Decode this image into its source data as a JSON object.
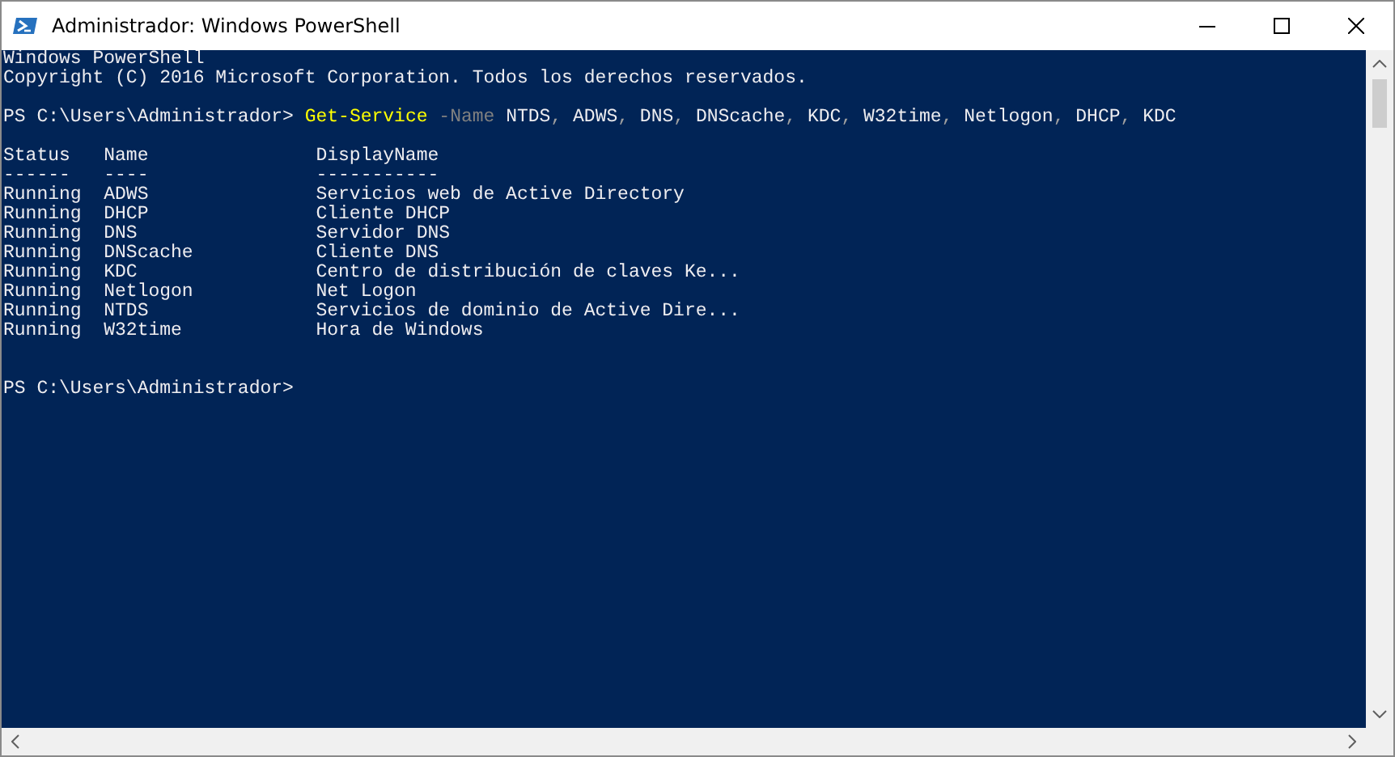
{
  "window": {
    "title": "Administrador: Windows PowerShell"
  },
  "console": {
    "banner": [
      {
        "segments": [
          {
            "kind": "plain",
            "text": "Windows PowerShell"
          }
        ]
      },
      {
        "segments": [
          {
            "kind": "plain",
            "text": "Copyright (C) 2016 Microsoft Corporation. Todos los derechos reservados."
          }
        ]
      }
    ],
    "command": {
      "segments": [
        {
          "kind": "plain",
          "text": "PS C:\\Users\\Administrador> "
        },
        {
          "kind": "command",
          "text": "Get-Service"
        },
        {
          "kind": "parameter",
          "text": " -Name"
        },
        {
          "kind": "plain",
          "text": " NTDS"
        },
        {
          "kind": "operator",
          "text": ","
        },
        {
          "kind": "plain",
          "text": " ADWS"
        },
        {
          "kind": "operator",
          "text": ","
        },
        {
          "kind": "plain",
          "text": " DNS"
        },
        {
          "kind": "operator",
          "text": ","
        },
        {
          "kind": "plain",
          "text": " DNScache"
        },
        {
          "kind": "operator",
          "text": ","
        },
        {
          "kind": "plain",
          "text": " KDC"
        },
        {
          "kind": "operator",
          "text": ","
        },
        {
          "kind": "plain",
          "text": " W32time"
        },
        {
          "kind": "operator",
          "text": ","
        },
        {
          "kind": "plain",
          "text": " Netlogon"
        },
        {
          "kind": "operator",
          "text": ","
        },
        {
          "kind": "plain",
          "text": " DHCP"
        },
        {
          "kind": "operator",
          "text": ","
        },
        {
          "kind": "plain",
          "text": " KDC"
        }
      ]
    },
    "table": {
      "columns": [
        {
          "label": "Status",
          "rule": "------"
        },
        {
          "label": "Name",
          "rule": "----"
        },
        {
          "label": "DisplayName",
          "rule": "-----------"
        }
      ],
      "rows": [
        [
          "Running",
          "ADWS",
          "Servicios web de Active Directory"
        ],
        [
          "Running",
          "DHCP",
          "Cliente DHCP"
        ],
        [
          "Running",
          "DNS",
          "Servidor DNS"
        ],
        [
          "Running",
          "DNScache",
          "Cliente DNS"
        ],
        [
          "Running",
          "KDC",
          "Centro de distribución de claves Ke..."
        ],
        [
          "Running",
          "Netlogon",
          "Net Logon"
        ],
        [
          "Running",
          "NTDS",
          "Servicios de dominio de Active Dire..."
        ],
        [
          "Running",
          "W32time",
          "Hora de Windows"
        ]
      ]
    },
    "prompt": {
      "segments": [
        {
          "kind": "plain",
          "text": "PS C:\\Users\\Administrador>"
        }
      ]
    }
  }
}
